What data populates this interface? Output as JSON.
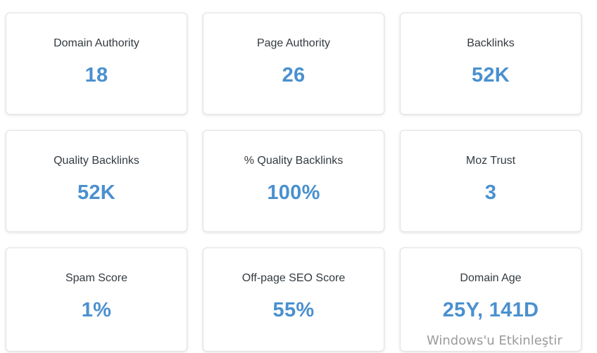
{
  "metrics": [
    {
      "label": "Domain Authority",
      "value": "18"
    },
    {
      "label": "Page Authority",
      "value": "26"
    },
    {
      "label": "Backlinks",
      "value": "52K"
    },
    {
      "label": "Quality Backlinks",
      "value": "52K"
    },
    {
      "label": "% Quality Backlinks",
      "value": "100%"
    },
    {
      "label": "Moz Trust",
      "value": "3"
    },
    {
      "label": "Spam Score",
      "value": "1%"
    },
    {
      "label": "Off-page SEO Score",
      "value": "55%"
    },
    {
      "label": "Domain Age",
      "value": "25Y, 141D"
    }
  ],
  "watermark": {
    "text": "Windows'u Etkinleştir"
  },
  "colors": {
    "value_accent": "#4a90cf",
    "label_text": "#333a40",
    "card_border": "#e3e3e3"
  }
}
